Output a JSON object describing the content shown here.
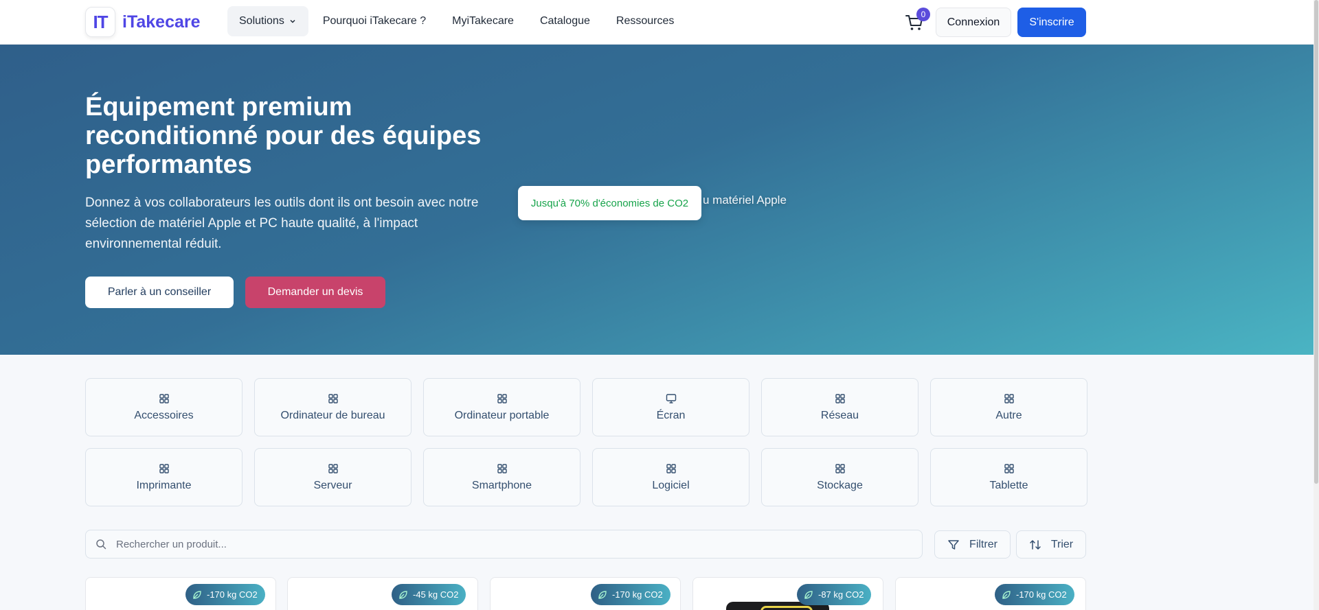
{
  "header": {
    "logo_mark": "IT",
    "logo_text": "iTakecare",
    "menu": [
      "Solutions",
      "Pourquoi iTakecare ?",
      "MyiTakecare",
      "Catalogue",
      "Ressources"
    ],
    "cart_count": "0",
    "login_label": "Connexion",
    "signup_label": "S'inscrire"
  },
  "hero": {
    "title": "Équipement premium reconditionné pour des équipes performantes",
    "subtitle": "Donnez à vos collaborateurs les outils dont ils ont besoin avec notre sélection de matériel Apple et PC haute qualité, à l'impact environnemental réduit.",
    "advisor_button": "Parler à un conseiller",
    "quote_button": "Demander un devis",
    "ticker_text": "u matériel Apple",
    "eco_badge": "Jusqu'à 70% d'économies de CO2"
  },
  "categories": [
    {
      "label": "Accessoires",
      "icon": "grid-icon"
    },
    {
      "label": "Ordinateur de bureau",
      "icon": "grid-icon"
    },
    {
      "label": "Ordinateur portable",
      "icon": "grid-icon"
    },
    {
      "label": "Écran",
      "icon": "monitor-icon"
    },
    {
      "label": "Réseau",
      "icon": "grid-icon"
    },
    {
      "label": "Autre",
      "icon": "grid-icon"
    },
    {
      "label": "Imprimante",
      "icon": "grid-icon"
    },
    {
      "label": "Serveur",
      "icon": "grid-icon"
    },
    {
      "label": "Smartphone",
      "icon": "grid-icon"
    },
    {
      "label": "Logiciel",
      "icon": "grid-icon"
    },
    {
      "label": "Stockage",
      "icon": "grid-icon"
    },
    {
      "label": "Tablette",
      "icon": "grid-icon"
    }
  ],
  "search": {
    "placeholder": "Rechercher un produit...",
    "filter_label": "Filtrer",
    "sort_label": "Trier"
  },
  "products": [
    {
      "co2": "-170 kg CO2"
    },
    {
      "co2": "-45 kg CO2"
    },
    {
      "co2": "-170 kg CO2"
    },
    {
      "co2": "-87 kg CO2"
    },
    {
      "co2": "-170 kg CO2"
    }
  ],
  "colors": {
    "brand": "#4f46e5",
    "primary_button": "#1e5ee6",
    "quote_button": "#c8436b",
    "eco_green": "#16a34a"
  }
}
